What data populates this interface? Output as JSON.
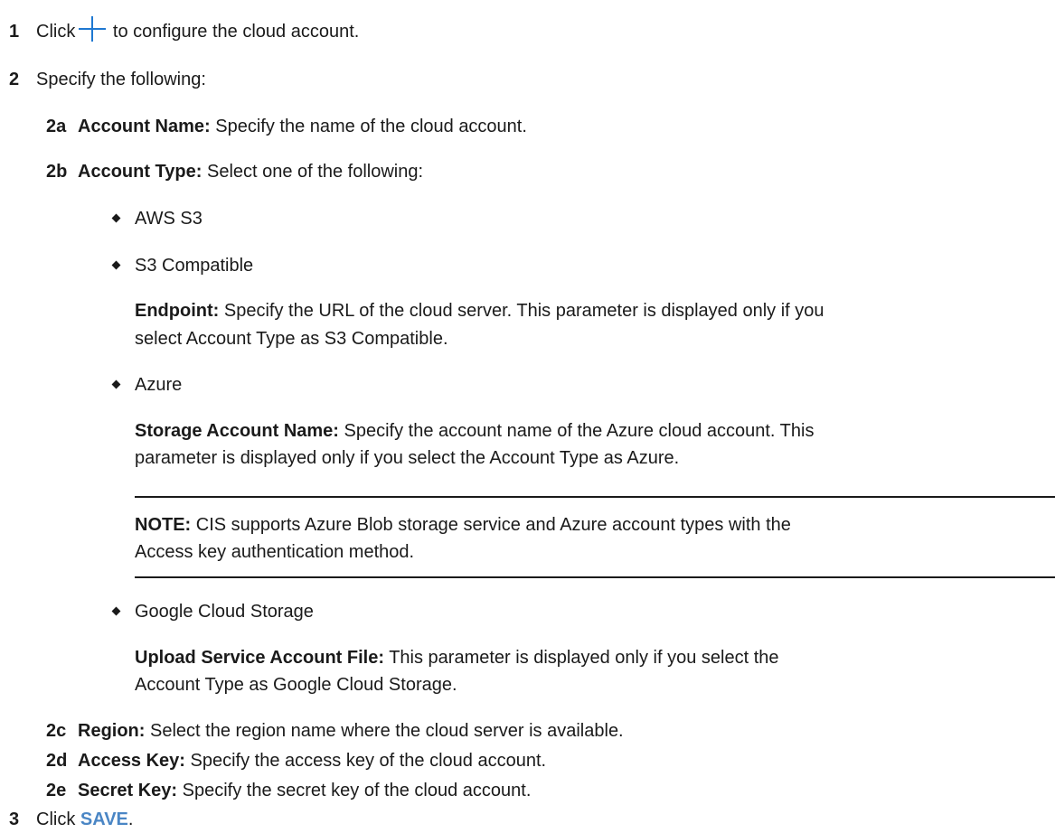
{
  "steps": {
    "s1": {
      "num": "1",
      "pre": "Click",
      "post": "to configure the cloud account."
    },
    "s2": {
      "num": "2",
      "text": "Specify the following:"
    },
    "s2a": {
      "num": "2a",
      "label": "Account Name:",
      "text": " Specify the name of the cloud account."
    },
    "s2b": {
      "num": "2b",
      "label": "Account Type:",
      "text": " Select one of the following:"
    },
    "s2c": {
      "num": "2c",
      "label": "Region:",
      "text": " Select the region name where the cloud server is available."
    },
    "s2d": {
      "num": "2d",
      "label": "Access Key:",
      "text": " Specify the access key of the cloud account."
    },
    "s2e": {
      "num": "2e",
      "label": "Secret Key:",
      "text": " Specify the secret key of the cloud account."
    },
    "s3": {
      "num": "3",
      "pre": "Click",
      "link": "SAVE",
      "post": "."
    }
  },
  "account_types": {
    "aws": "AWS S3",
    "s3c": "S3 Compatible",
    "s3c_param_label": "Endpoint:",
    "s3c_param_line1": " Specify the URL of the cloud server. This parameter is displayed only if you",
    "s3c_param_line2": "select Account Type as S3 Compatible.",
    "azure": "Azure",
    "azure_param_label": "Storage Account Name:",
    "azure_param_line1": " Specify the account name of the Azure cloud account. This",
    "azure_param_line2": "parameter is displayed only if you select the Account Type as Azure.",
    "gcs": "Google Cloud Storage",
    "gcs_param_label": "Upload Service Account File:",
    "gcs_param_line1": " This parameter is displayed only if you select the",
    "gcs_param_line2": "Account Type as Google Cloud Storage."
  },
  "note": {
    "label": "NOTE:",
    "line1": " CIS supports Azure Blob storage service and Azure account types with the",
    "line2": "Access key authentication method."
  }
}
